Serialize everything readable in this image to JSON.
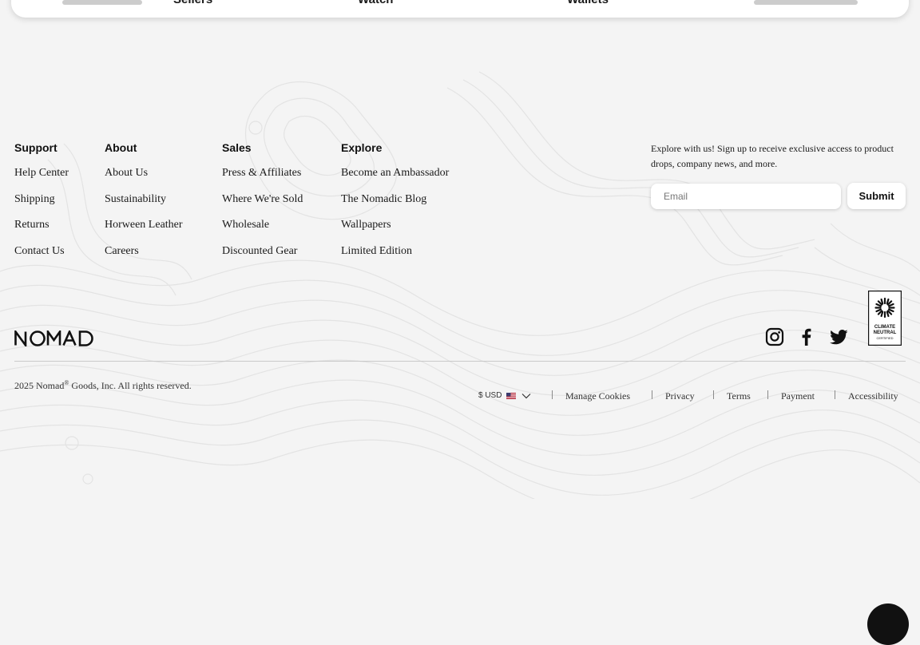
{
  "topnav": {
    "items": [
      "Sellers",
      "Watch",
      "Wallets"
    ]
  },
  "footer": {
    "columns": [
      {
        "heading": "Support",
        "links": [
          "Help Center",
          "Shipping",
          "Returns",
          "Contact Us"
        ]
      },
      {
        "heading": "About",
        "links": [
          "About Us",
          "Sustainability",
          "Horween Leather",
          "Careers"
        ]
      },
      {
        "heading": "Sales",
        "links": [
          "Press & Affiliates",
          "Where We're Sold",
          "Wholesale",
          "Discounted Gear"
        ]
      },
      {
        "heading": "Explore",
        "links": [
          "Become an Ambassador",
          "The Nomadic Blog",
          "Wallpapers",
          "Limited Edition"
        ]
      }
    ],
    "newsletter": {
      "text": "Explore with us! Sign up to receive exclusive access to product drops, company news, and more.",
      "email_placeholder": "Email",
      "submit_label": "Submit"
    },
    "logo_text": "NOMAD",
    "social_icons": [
      "instagram-icon",
      "facebook-icon",
      "twitter-icon"
    ],
    "badge_text": "CLIMATE NEUTRAL CERTIFIED",
    "copyright": {
      "prefix": "2025 Nomad",
      "mark": "®",
      "suffix": " Goods, Inc. All rights reserved."
    },
    "currency": "$ USD",
    "legal_links": [
      "Manage Cookies",
      "Privacy",
      "Terms",
      "Payment",
      "Accessibility"
    ]
  },
  "colors": {
    "background": "#f4f4f4",
    "text": "#1a1a1a",
    "card": "#ffffff",
    "accent_dark": "#111111"
  }
}
